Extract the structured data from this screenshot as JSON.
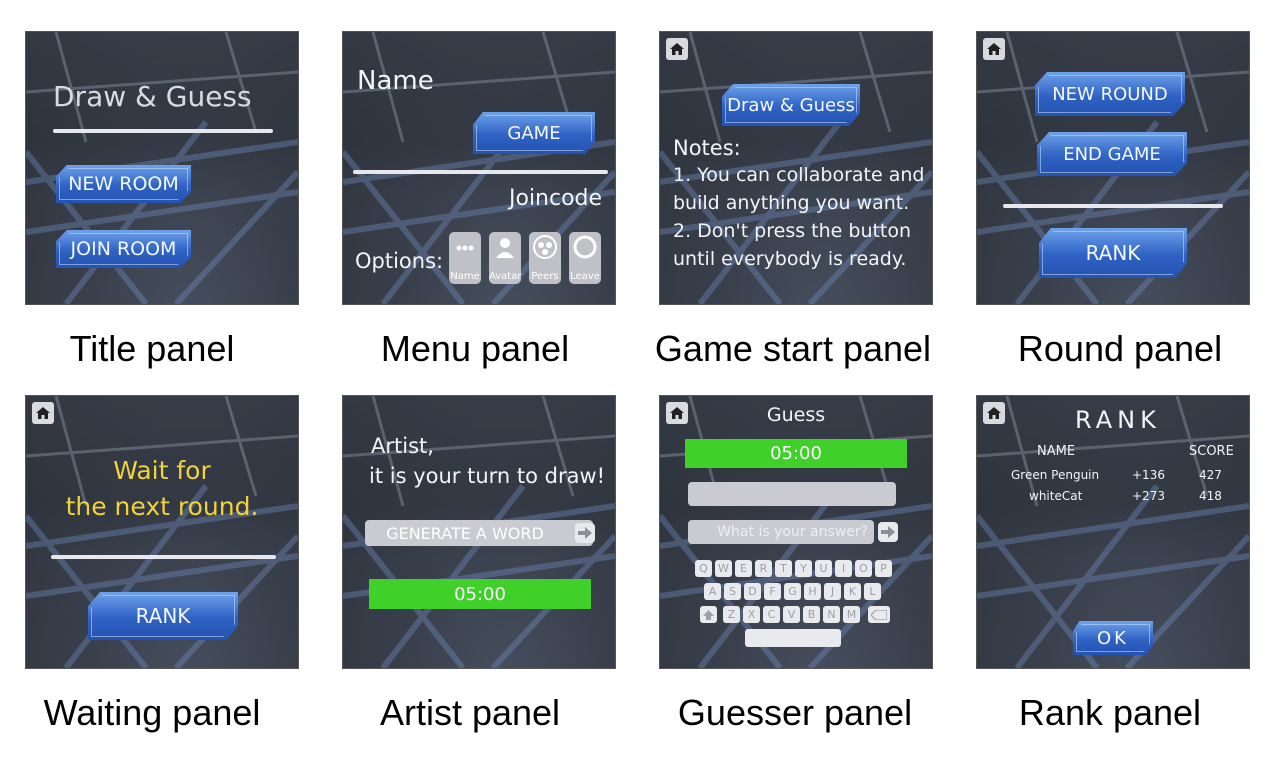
{
  "captions": [
    "Title panel",
    "Menu panel",
    "Game start panel",
    "Round panel",
    "Waiting panel",
    "Artist panel",
    "Guesser panel",
    "Rank panel"
  ],
  "title_panel": {
    "title": "Draw & Guess",
    "new_room": "NEW ROOM",
    "join_room": "JOIN ROOM"
  },
  "menu_panel": {
    "name_label": "Name",
    "game_button": "GAME",
    "joincode_label": "Joincode",
    "options_label": "Options:",
    "options": [
      {
        "label": "Name",
        "icon": "dots-icon"
      },
      {
        "label": "Avatar",
        "icon": "person-icon"
      },
      {
        "label": "Peers",
        "icon": "peers-icon"
      },
      {
        "label": "Leave",
        "icon": "circle-icon"
      }
    ]
  },
  "game_start_panel": {
    "title_button": "Draw & Guess",
    "notes_title": "Notes:",
    "notes": [
      "1. You can collaborate and",
      "build anything you want.",
      "2. Don't press the button",
      "until everybody is ready."
    ]
  },
  "round_panel": {
    "new_round": "NEW ROUND",
    "end_game": "END GAME",
    "rank": "RANK"
  },
  "waiting_panel": {
    "message_line1": "Wait for",
    "message_line2": "the next round.",
    "rank": "RANK"
  },
  "artist_panel": {
    "line1": "Artist,",
    "line2": "it is your turn to draw!",
    "generate": "GENERATE A WORD",
    "timer": "05:00"
  },
  "guesser_panel": {
    "title": "Guess",
    "timer": "05:00",
    "placeholder": "What is your answer?",
    "keys_row1": [
      "Q",
      "W",
      "E",
      "R",
      "T",
      "Y",
      "U",
      "I",
      "O",
      "P"
    ],
    "keys_row2": [
      "A",
      "S",
      "D",
      "F",
      "G",
      "H",
      "J",
      "K",
      "L"
    ],
    "keys_row3": [
      "Z",
      "X",
      "C",
      "V",
      "B",
      "N",
      "M"
    ]
  },
  "rank_panel": {
    "title": "RANK",
    "col_name": "NAME",
    "col_score": "SCORE",
    "rows": [
      {
        "name": "Green Penguin",
        "delta": "+136",
        "score": "427"
      },
      {
        "name": "whiteCat",
        "delta": "+273",
        "score": "418"
      }
    ],
    "ok": "OK"
  },
  "colors": {
    "button_blue": "#2f62c4",
    "timer_green": "#3fd02a",
    "waiting_yellow": "#f0d23a"
  }
}
